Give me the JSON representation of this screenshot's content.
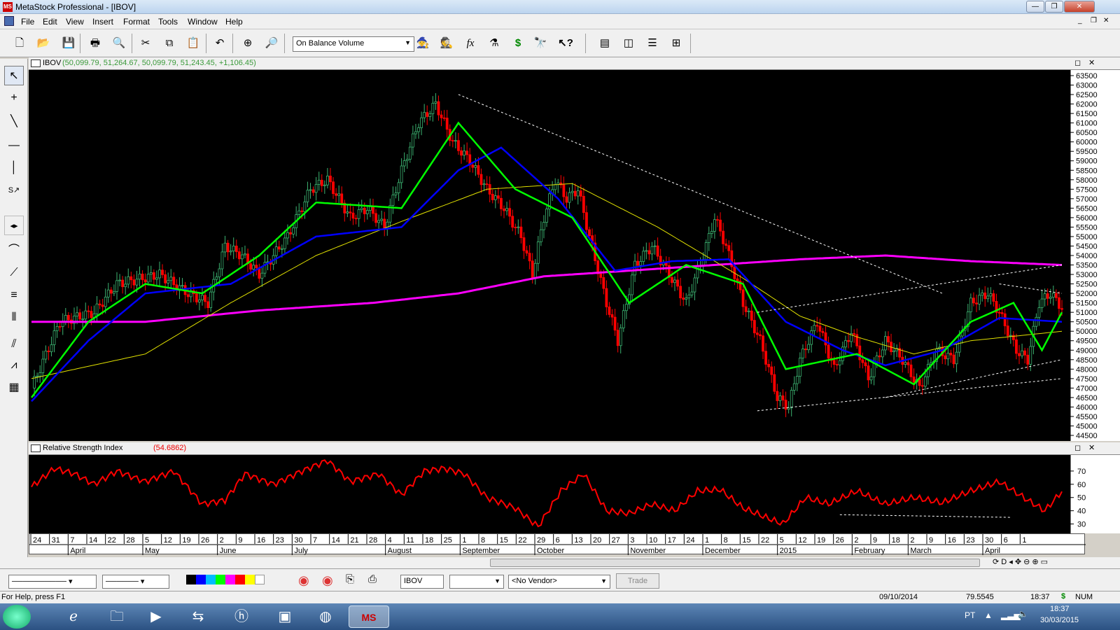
{
  "window": {
    "title": "MetaStock Professional - [IBOV]",
    "logo": "MS"
  },
  "menu": [
    "File",
    "Edit",
    "View",
    "Insert",
    "Format",
    "Tools",
    "Window",
    "Help"
  ],
  "toolbar": {
    "indicator": "On Balance Volume",
    "icons": [
      "new-icon",
      "open-icon",
      "save-icon",
      "print-icon",
      "print-preview-icon",
      "cut-icon",
      "copy-icon",
      "paste-icon",
      "undo-icon",
      "crosshair-icon",
      "zoom-icon",
      "expert-icon",
      "explorer-icon",
      "formula-icon",
      "system-tester-icon",
      "dollar-icon",
      "binoculars-icon",
      "help-icon",
      "layout-1-icon",
      "layout-2-icon",
      "layout-3-icon",
      "layout-4-icon"
    ]
  },
  "left_tools": [
    "pointer-icon",
    "crosshair-icon",
    "trendline-icon",
    "horizontal-line-icon",
    "vertical-line-icon",
    "speed-line-icon",
    "scroll-icon",
    "cycle-icon",
    "fibonacci-fan-icon",
    "fibonacci-retracement-icon",
    "time-zones-icon",
    "channel-icon",
    "gann-fan-icon",
    "grid-icon"
  ],
  "price_pane": {
    "symbol": "IBOV",
    "ohlc": "(50,099.79, 51,264.67, 50,099.79, 51,243.45, +1,106.45)"
  },
  "rsi_pane": {
    "name": "Relative Strength Index",
    "value": "(54.6862)"
  },
  "date_axis": {
    "days": [
      "24",
      "31",
      "7",
      "14",
      "22",
      "28",
      "5",
      "12",
      "19",
      "26",
      "2",
      "9",
      "16",
      "23",
      "30",
      "7",
      "14",
      "21",
      "28",
      "4",
      "11",
      "18",
      "25",
      "1",
      "8",
      "15",
      "22",
      "29",
      "6",
      "13",
      "20",
      "27",
      "3",
      "10",
      "17",
      "24",
      "1",
      "8",
      "15",
      "22",
      "5",
      "12",
      "19",
      "26",
      "2",
      "9",
      "18",
      "2",
      "9",
      "16",
      "23",
      "30",
      "6",
      "1"
    ],
    "months": [
      "April",
      "May",
      "June",
      "July",
      "August",
      "September",
      "October",
      "November",
      "December",
      "2015",
      "February",
      "March",
      "April"
    ]
  },
  "bottom": {
    "symbol": "IBOV",
    "vendor": "<No Vendor>",
    "trade": "Trade"
  },
  "status": {
    "help": "For Help, press F1",
    "date": "09/10/2014",
    "value": "79.5545",
    "time": "18:37",
    "num": "NUM"
  },
  "taskbar": {
    "lang": "PT",
    "time": "18:37",
    "date": "30/03/2015"
  },
  "colors": {
    "up": "#3cb371",
    "down": "#ff0000",
    "sma_fast": "#00ff00",
    "sma_mid": "#0000ff",
    "sma_slow": "#e0e000",
    "sma_long": "#ff00ff",
    "rsi": "#ff0000"
  },
  "chart_data": [
    {
      "type": "candlestick",
      "title": "IBOV",
      "ylim": [
        44500,
        63500
      ],
      "y_ticks": [
        44500,
        45000,
        45500,
        46000,
        46500,
        47000,
        47500,
        48000,
        48500,
        49000,
        49500,
        50000,
        50500,
        51000,
        51500,
        52000,
        52500,
        53000,
        53500,
        54000,
        54500,
        55000,
        55500,
        56000,
        56500,
        57000,
        57500,
        58000,
        58500,
        59000,
        59500,
        60000,
        60500,
        61000,
        61500,
        62000,
        62500,
        63000,
        63500
      ],
      "close_path": [
        [
          0,
          47000
        ],
        [
          10,
          50500
        ],
        [
          22,
          51000
        ],
        [
          30,
          52500
        ],
        [
          45,
          53000
        ],
        [
          55,
          52000
        ],
        [
          62,
          51500
        ],
        [
          68,
          54500
        ],
        [
          74,
          54000
        ],
        [
          80,
          53000
        ],
        [
          90,
          55000
        ],
        [
          98,
          57500
        ],
        [
          104,
          58000
        ],
        [
          108,
          57000
        ],
        [
          112,
          56000
        ],
        [
          118,
          56500
        ],
        [
          124,
          55500
        ],
        [
          130,
          58500
        ],
        [
          136,
          61000
        ],
        [
          142,
          62000
        ],
        [
          148,
          60000
        ],
        [
          154,
          59000
        ],
        [
          160,
          57500
        ],
        [
          166,
          56500
        ],
        [
          172,
          55000
        ],
        [
          176,
          53000
        ],
        [
          180,
          56000
        ],
        [
          184,
          58000
        ],
        [
          188,
          57000
        ],
        [
          192,
          57500
        ],
        [
          196,
          55000
        ],
        [
          202,
          51500
        ],
        [
          206,
          49500
        ],
        [
          212,
          53500
        ],
        [
          218,
          54500
        ],
        [
          224,
          53000
        ],
        [
          230,
          51500
        ],
        [
          236,
          54000
        ],
        [
          240,
          56000
        ],
        [
          244,
          54500
        ],
        [
          250,
          51500
        ],
        [
          256,
          49500
        ],
        [
          262,
          46500
        ],
        [
          266,
          46000
        ],
        [
          270,
          48500
        ],
        [
          276,
          50500
        ],
        [
          282,
          48000
        ],
        [
          288,
          50000
        ],
        [
          294,
          47500
        ],
        [
          300,
          49500
        ],
        [
          306,
          48500
        ],
        [
          312,
          47000
        ],
        [
          318,
          49000
        ],
        [
          324,
          48500
        ],
        [
          330,
          51500
        ],
        [
          336,
          52000
        ],
        [
          340,
          51000
        ],
        [
          346,
          49000
        ],
        [
          350,
          48500
        ],
        [
          354,
          51500
        ],
        [
          358,
          52000
        ],
        [
          362,
          51243
        ]
      ],
      "sma_long": [
        [
          0,
          50500
        ],
        [
          40,
          50500
        ],
        [
          80,
          51100
        ],
        [
          120,
          51500
        ],
        [
          150,
          52000
        ],
        [
          180,
          52900
        ],
        [
          210,
          53200
        ],
        [
          240,
          53500
        ],
        [
          270,
          53800
        ],
        [
          300,
          54000
        ],
        [
          330,
          53700
        ],
        [
          362,
          53500
        ]
      ],
      "sma_slow": [
        [
          0,
          47500
        ],
        [
          40,
          48800
        ],
        [
          70,
          51500
        ],
        [
          100,
          54000
        ],
        [
          130,
          55800
        ],
        [
          160,
          57500
        ],
        [
          190,
          57800
        ],
        [
          220,
          55500
        ],
        [
          250,
          52800
        ],
        [
          270,
          50800
        ],
        [
          290,
          49700
        ],
        [
          310,
          48800
        ],
        [
          330,
          49500
        ],
        [
          362,
          50000
        ]
      ],
      "sma_mid": [
        [
          0,
          46300
        ],
        [
          20,
          49500
        ],
        [
          40,
          52000
        ],
        [
          70,
          52500
        ],
        [
          100,
          55000
        ],
        [
          130,
          55500
        ],
        [
          150,
          58500
        ],
        [
          165,
          59700
        ],
        [
          185,
          57000
        ],
        [
          205,
          53200
        ],
        [
          225,
          53700
        ],
        [
          245,
          53800
        ],
        [
          265,
          50500
        ],
        [
          285,
          49000
        ],
        [
          300,
          48200
        ],
        [
          320,
          49000
        ],
        [
          340,
          50700
        ],
        [
          362,
          50500
        ]
      ],
      "sma_fast": [
        [
          0,
          46500
        ],
        [
          20,
          50500
        ],
        [
          40,
          52500
        ],
        [
          60,
          52000
        ],
        [
          80,
          54000
        ],
        [
          100,
          56800
        ],
        [
          130,
          56500
        ],
        [
          150,
          61000
        ],
        [
          170,
          57500
        ],
        [
          190,
          56000
        ],
        [
          210,
          51500
        ],
        [
          230,
          53500
        ],
        [
          250,
          52500
        ],
        [
          265,
          48000
        ],
        [
          290,
          48800
        ],
        [
          310,
          47200
        ],
        [
          330,
          50500
        ],
        [
          345,
          51500
        ],
        [
          355,
          49000
        ],
        [
          362,
          51000
        ]
      ],
      "trendlines": [
        [
          [
            150,
            62500
          ],
          [
            320,
            52000
          ]
        ],
        [
          [
            255,
            45800
          ],
          [
            362,
            47500
          ]
        ],
        [
          [
            255,
            51000
          ],
          [
            362,
            53500
          ]
        ],
        [
          [
            300,
            46500
          ],
          [
            362,
            48500
          ]
        ],
        [
          [
            340,
            52500
          ],
          [
            362,
            52000
          ]
        ]
      ],
      "annotations": []
    },
    {
      "type": "line",
      "title": "Relative Strength Index",
      "ylim": [
        25,
        80
      ],
      "y_ticks": [
        30,
        40,
        50,
        60,
        70
      ],
      "values": [
        [
          0,
          58
        ],
        [
          8,
          72
        ],
        [
          15,
          68
        ],
        [
          22,
          60
        ],
        [
          30,
          70
        ],
        [
          40,
          62
        ],
        [
          50,
          70
        ],
        [
          60,
          45
        ],
        [
          68,
          48
        ],
        [
          75,
          68
        ],
        [
          85,
          60
        ],
        [
          95,
          70
        ],
        [
          104,
          78
        ],
        [
          112,
          62
        ],
        [
          122,
          68
        ],
        [
          130,
          52
        ],
        [
          138,
          70
        ],
        [
          145,
          72
        ],
        [
          152,
          68
        ],
        [
          160,
          50
        ],
        [
          170,
          42
        ],
        [
          178,
          28
        ],
        [
          186,
          55
        ],
        [
          194,
          68
        ],
        [
          202,
          40
        ],
        [
          210,
          38
        ],
        [
          218,
          45
        ],
        [
          226,
          40
        ],
        [
          234,
          55
        ],
        [
          242,
          56
        ],
        [
          250,
          42
        ],
        [
          258,
          35
        ],
        [
          264,
          30
        ],
        [
          272,
          50
        ],
        [
          280,
          45
        ],
        [
          290,
          55
        ],
        [
          300,
          45
        ],
        [
          310,
          50
        ],
        [
          320,
          46
        ],
        [
          330,
          55
        ],
        [
          340,
          62
        ],
        [
          350,
          48
        ],
        [
          356,
          40
        ],
        [
          362,
          54.69
        ]
      ]
    }
  ]
}
